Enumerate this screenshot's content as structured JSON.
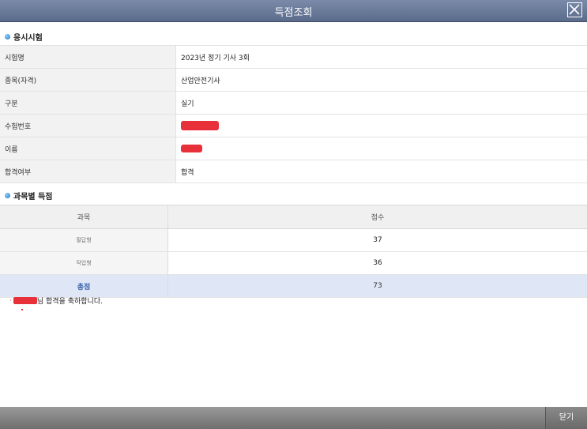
{
  "window": {
    "title": "득점조회",
    "close_icon": "close-icon"
  },
  "exam_section": {
    "heading": "응시시험"
  },
  "exam_info": {
    "rows": [
      {
        "label": "시험명",
        "value": "2023년 정기 기사 3회"
      },
      {
        "label": "종목(자격)",
        "value": "산업안전기사"
      },
      {
        "label": "구분",
        "value": "실기"
      },
      {
        "label": "수험번호",
        "value": ""
      },
      {
        "label": "이름",
        "value": ""
      },
      {
        "label": "합격여부",
        "value": "합격"
      }
    ]
  },
  "score_section": {
    "heading": "과목별 득점"
  },
  "score_table": {
    "headers": [
      "과목",
      "점수"
    ],
    "rows": [
      {
        "subject": "필답형",
        "score": "37"
      },
      {
        "subject": "작업형",
        "score": "36"
      }
    ],
    "total": {
      "subject": "총점",
      "score": "73"
    }
  },
  "message": {
    "text": "님 합격을 축하합니다."
  },
  "footer": {
    "close_label": "닫기"
  },
  "colors": {
    "titlebar": "#5b6b8b",
    "total_row": "#dfe7f7",
    "redaction": "#e8303a"
  }
}
